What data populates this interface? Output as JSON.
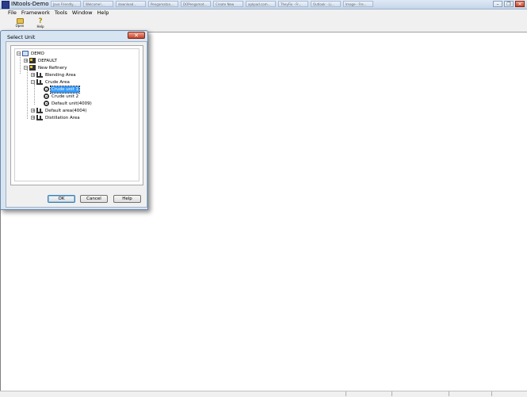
{
  "window": {
    "title": "INtools-Demo",
    "taskbar_tabs": [
      "Java Friendly...",
      "Welcome!...",
      "download...",
      "Pengamatan...",
      "DOPengamat...",
      "Create New",
      "apkpad.com...",
      "TheyFix - Fr...",
      "Outlook - Li...",
      "Image - Fre..."
    ],
    "controls": {
      "minimize": "–",
      "maximize": "❐",
      "close": "✕"
    }
  },
  "menu": [
    "File",
    "Framework",
    "Tools",
    "Window",
    "Help"
  ],
  "toolbar": {
    "open_label": "Open",
    "help_label": "Help"
  },
  "dialog": {
    "title": "Select Unit",
    "close_glyph": "✕",
    "tree": [
      {
        "label": "DEMO",
        "toggle": "−",
        "level": 0,
        "icon": "database-icon"
      },
      {
        "label": "DEFAULT",
        "toggle": "+",
        "level": 1,
        "icon": "plant-icon"
      },
      {
        "label": "New Refinery",
        "toggle": "−",
        "level": 1,
        "icon": "plant-icon"
      },
      {
        "label": "Blending Area",
        "toggle": "+",
        "level": 2,
        "icon": "area-icon"
      },
      {
        "label": "Crude Area",
        "toggle": "−",
        "level": 2,
        "icon": "area-icon"
      },
      {
        "label": "Crude unit 1",
        "toggle": "",
        "level": 3,
        "icon": "unit-icon",
        "selected": true
      },
      {
        "label": "Crude unit 2",
        "toggle": "",
        "level": 3,
        "icon": "unit-icon"
      },
      {
        "label": "Default unit(4009)",
        "toggle": "",
        "level": 3,
        "icon": "unit-icon"
      },
      {
        "label": "Default area(4004)",
        "toggle": "+",
        "level": 2,
        "icon": "area-icon"
      },
      {
        "label": "Distillation Area",
        "toggle": "+",
        "level": 2,
        "icon": "area-icon"
      }
    ],
    "buttons": {
      "ok": "OK",
      "cancel": "Cancel",
      "help": "Help"
    }
  },
  "colors": {
    "selection": "#3399ff",
    "close_button": "#c64127",
    "dialog_frame": "#d7e4f2"
  }
}
